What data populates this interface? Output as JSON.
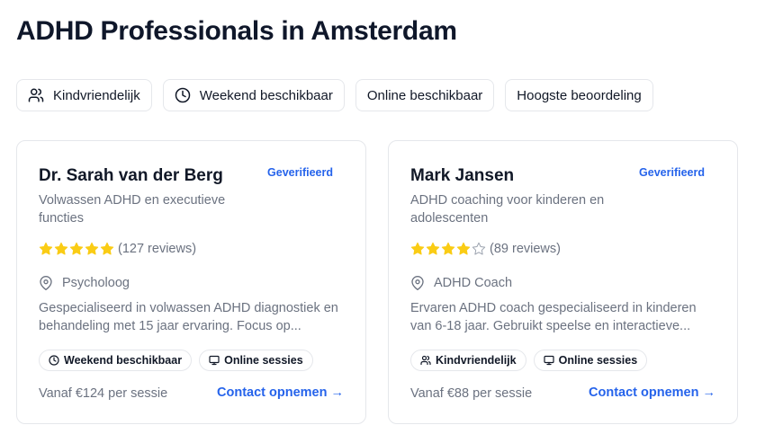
{
  "page": {
    "title": "ADHD Professionals in Amsterdam"
  },
  "filters": [
    {
      "label": "Kindvriendelijk",
      "icon": "users-icon"
    },
    {
      "label": "Weekend beschikbaar",
      "icon": "clock-icon"
    },
    {
      "label": "Online beschikbaar",
      "icon": ""
    },
    {
      "label": "Hoogste beoordeling",
      "icon": ""
    }
  ],
  "cards": [
    {
      "name": "Dr. Sarah van der Berg",
      "verified": "Geverifieerd",
      "specialty": "Volwassen ADHD en executieve functies",
      "rating": 5,
      "reviews": "(127 reviews)",
      "profession": "Psycholoog",
      "description": "Gespecialiseerd in volwassen ADHD diagnostiek en behandeling met 15 jaar ervaring. Focus op...",
      "tags": [
        {
          "label": "Weekend beschikbaar",
          "icon": "clock-icon"
        },
        {
          "label": "Online sessies",
          "icon": "monitor-icon"
        }
      ],
      "price": "Vanaf €124 per sessie",
      "contact": "Contact opnemen →"
    },
    {
      "name": "Mark Jansen",
      "verified": "Geverifieerd",
      "specialty": "ADHD coaching voor kinderen en adolescenten",
      "rating": 4,
      "reviews": "(89 reviews)",
      "profession": "ADHD Coach",
      "description": "Ervaren ADHD coach gespecialiseerd in kinderen van 6-18 jaar. Gebruikt speelse en interactieve...",
      "tags": [
        {
          "label": "Kindvriendelijk",
          "icon": "users-icon"
        },
        {
          "label": "Online sessies",
          "icon": "monitor-icon"
        }
      ],
      "price": "Vanaf €88 per sessie",
      "contact": "Contact opnemen →"
    }
  ],
  "colors": {
    "accent": "#2563eb",
    "star": "#facc15",
    "muted": "#6b7280",
    "border": "#e5e7eb"
  }
}
